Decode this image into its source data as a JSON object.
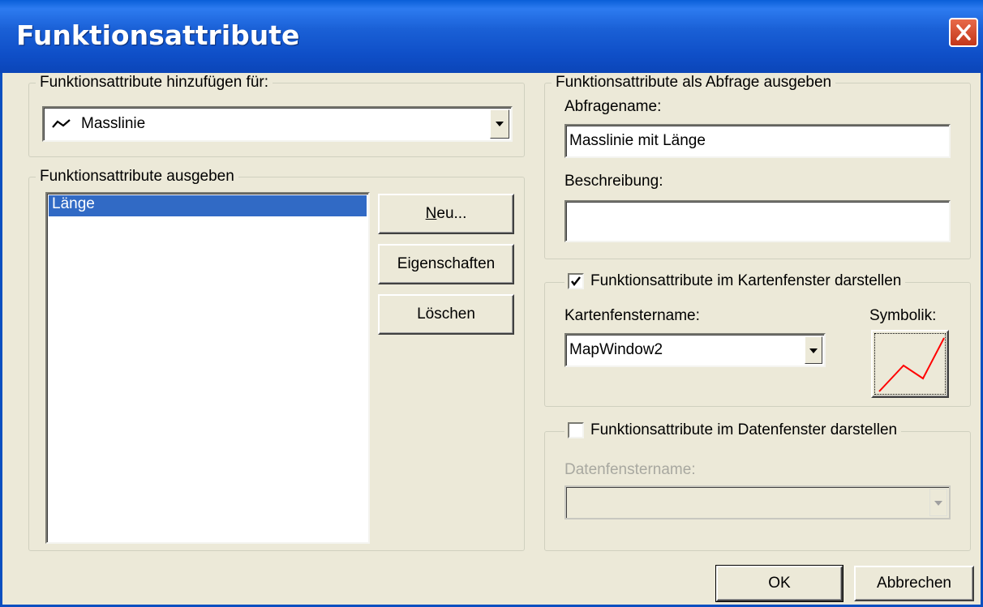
{
  "window": {
    "title": "Funktionsattribute"
  },
  "group_add": {
    "legend": "Funktionsattribute hinzufügen für:",
    "combo_value": "Masslinie",
    "combo_icon": "line-symbol-icon"
  },
  "group_output": {
    "legend": "Funktionsattribute ausgeben",
    "items": [
      "Länge"
    ],
    "buttons": {
      "new": "Neu...",
      "properties": "Eigenschaften",
      "delete": "Löschen"
    }
  },
  "group_query": {
    "legend": "Funktionsattribute als Abfrage ausgeben",
    "query_name_label": "Abfragename:",
    "query_name_value": "Masslinie mit Länge",
    "description_label": "Beschreibung:",
    "description_value": ""
  },
  "group_map": {
    "legend": "Funktionsattribute im Kartenfenster darstellen",
    "checked": true,
    "window_name_label": "Kartenfenstername:",
    "window_name_value": "MapWindow2",
    "symbol_label": "Symbolik:",
    "symbol_color": "#ff0000"
  },
  "group_data": {
    "legend": "Funktionsattribute im Datenfenster darstellen",
    "checked": false,
    "window_name_label": "Datenfenstername:",
    "window_name_value": ""
  },
  "footer": {
    "ok": "OK",
    "cancel": "Abbrechen"
  }
}
